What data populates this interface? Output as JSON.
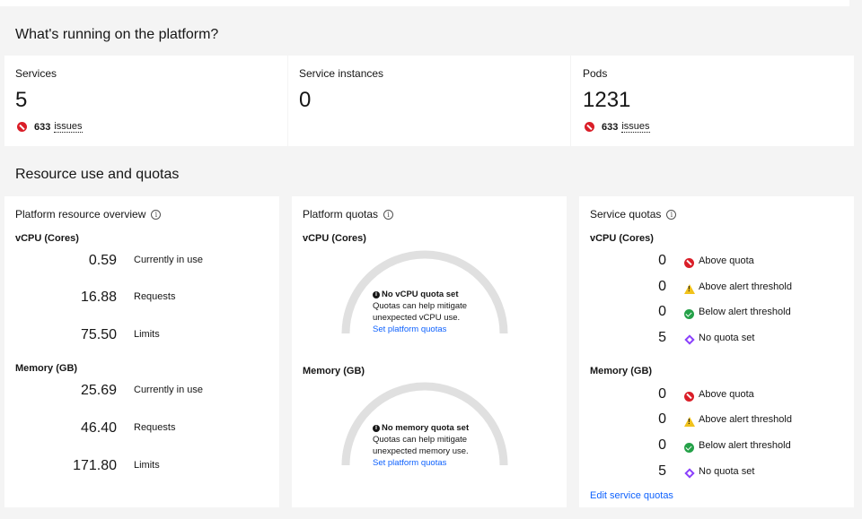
{
  "running": {
    "title": "What's running on the platform?",
    "cards": [
      {
        "label": "Services",
        "value": "5",
        "issues_count": "633",
        "issues_word": "issues"
      },
      {
        "label": "Service instances",
        "value": "0"
      },
      {
        "label": "Pods",
        "value": "1231",
        "issues_count": "633",
        "issues_word": "issues"
      }
    ]
  },
  "resources": {
    "title": "Resource use and quotas",
    "overview": {
      "title": "Platform resource overview",
      "vcpu": {
        "heading": "vCPU (Cores)",
        "rows": [
          {
            "value": "0.59",
            "label": "Currently in use"
          },
          {
            "value": "16.88",
            "label": "Requests"
          },
          {
            "value": "75.50",
            "label": "Limits"
          }
        ]
      },
      "memory": {
        "heading": "Memory (GB)",
        "rows": [
          {
            "value": "25.69",
            "label": "Currently in use"
          },
          {
            "value": "46.40",
            "label": "Requests"
          },
          {
            "value": "171.80",
            "label": "Limits"
          }
        ]
      }
    },
    "platform_quotas": {
      "title": "Platform quotas",
      "vcpu": {
        "heading": "vCPU (Cores)",
        "msg_title": "No vCPU quota set",
        "msg_line1": "Quotas can help mitigate",
        "msg_line2": "unexpected vCPU use.",
        "link": "Set platform quotas"
      },
      "memory": {
        "heading": "Memory (GB)",
        "msg_title": "No memory quota set",
        "msg_line1": "Quotas can help mitigate",
        "msg_line2": "unexpected memory use.",
        "link": "Set platform quotas"
      }
    },
    "service_quotas": {
      "title": "Service quotas",
      "vcpu": {
        "heading": "vCPU (Cores)",
        "rows": [
          {
            "value": "0",
            "label": "Above quota",
            "icon": "error-icon"
          },
          {
            "value": "0",
            "label": "Above alert threshold",
            "icon": "warning-icon"
          },
          {
            "value": "0",
            "label": "Below alert threshold",
            "icon": "success-icon"
          },
          {
            "value": "5",
            "label": "No quota set",
            "icon": "diamond-icon"
          }
        ]
      },
      "memory": {
        "heading": "Memory (GB)",
        "rows": [
          {
            "value": "0",
            "label": "Above quota",
            "icon": "error-icon"
          },
          {
            "value": "0",
            "label": "Above alert threshold",
            "icon": "warning-icon"
          },
          {
            "value": "0",
            "label": "Below alert threshold",
            "icon": "success-icon"
          },
          {
            "value": "5",
            "label": "No quota set",
            "icon": "diamond-icon"
          }
        ]
      },
      "edit_link": "Edit service quotas"
    }
  },
  "colors": {
    "error": "#da1e28",
    "warning": "#f1c21b",
    "success": "#24a148",
    "no_quota": "#8a3ffc",
    "link": "#0f62fe",
    "gauge": "#e0e0e0"
  }
}
